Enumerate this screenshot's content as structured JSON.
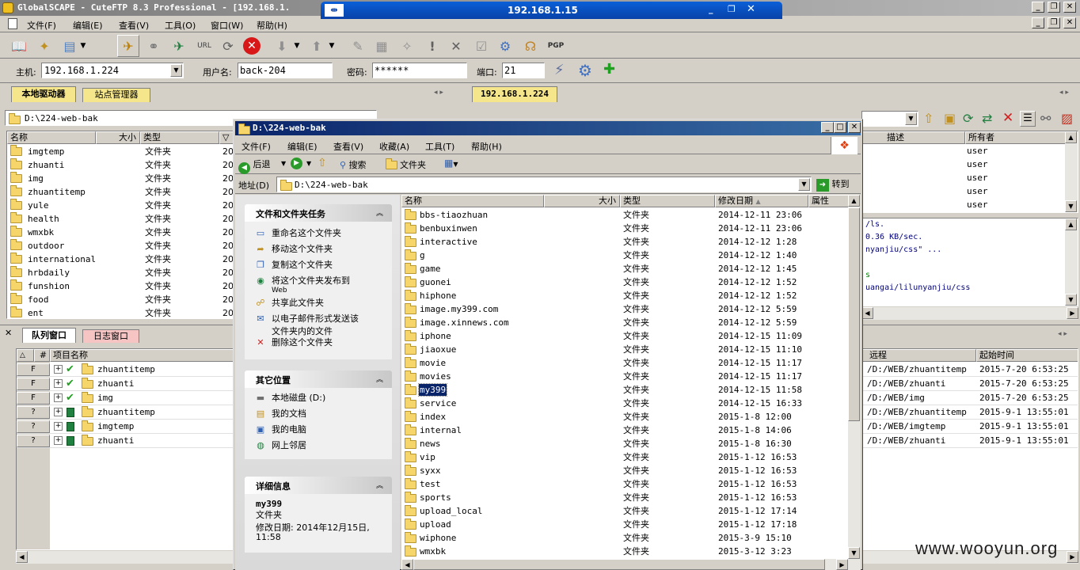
{
  "app": {
    "title": "GlobalSCAPE - CuteFTP 8.3 Professional - [192.168.1.",
    "menu": [
      "文件(F)",
      "编辑(E)",
      "查看(V)",
      "工具(O)",
      "窗口(W)",
      "帮助(H)"
    ],
    "remote_title": "192.168.1.15"
  },
  "connection": {
    "host_label": "主机:",
    "host_value": "192.168.1.224",
    "user_label": "用户名:",
    "user_value": "back-204",
    "pass_label": "密码:",
    "pass_value": "******",
    "port_label": "端口:",
    "port_value": "21"
  },
  "left_pane": {
    "tabs": [
      "本地驱动器",
      "站点管理器"
    ],
    "path": "D:\\224-web-bak",
    "columns": [
      "名称",
      "大小",
      "类型"
    ],
    "rows": [
      {
        "name": "imgtemp",
        "type": "文件夹",
        "d": "20"
      },
      {
        "name": "zhuanti",
        "type": "文件夹",
        "d": "20"
      },
      {
        "name": "img",
        "type": "文件夹",
        "d": "20"
      },
      {
        "name": "zhuantitemp",
        "type": "文件夹",
        "d": "20"
      },
      {
        "name": "yule",
        "type": "文件夹",
        "d": "20"
      },
      {
        "name": "health",
        "type": "文件夹",
        "d": "20"
      },
      {
        "name": "wmxbk",
        "type": "文件夹",
        "d": "20"
      },
      {
        "name": "outdoor",
        "type": "文件夹",
        "d": "20"
      },
      {
        "name": "international",
        "type": "文件夹",
        "d": "20"
      },
      {
        "name": "hrbdaily",
        "type": "文件夹",
        "d": "20"
      },
      {
        "name": "funshion",
        "type": "文件夹",
        "d": "20"
      },
      {
        "name": "food",
        "type": "文件夹",
        "d": "20"
      },
      {
        "name": "ent",
        "type": "文件夹",
        "d": "20"
      }
    ]
  },
  "right_pane": {
    "tab": "192.168.1.224",
    "columns": [
      "描述",
      "所有者"
    ],
    "owners": [
      "user",
      "user",
      "user",
      "user",
      "user"
    ],
    "log_lines": [
      "/ls.",
      "0.36 KB/sec.",
      "nyanjiu/css\" ...",
      "",
      "s",
      "uangai/lilunyanjiu/css"
    ]
  },
  "queue": {
    "tabs": [
      "队列窗口",
      "日志窗口"
    ],
    "columns": [
      "#",
      "项目名称"
    ],
    "right_columns": [
      "远程",
      "起始时间"
    ],
    "rows": [
      {
        "status": "F",
        "name": "zhuantitemp",
        "remote": "/D:/WEB/zhuantitemp",
        "time": "2015-7-20 6:53:25",
        "done": true
      },
      {
        "status": "F",
        "name": "zhuanti",
        "remote": "/D:/WEB/zhuanti",
        "time": "2015-7-20 6:53:25",
        "done": true
      },
      {
        "status": "F",
        "name": "img",
        "remote": "/D:/WEB/img",
        "time": "2015-7-20 6:53:25",
        "done": true
      },
      {
        "status": "?",
        "name": "zhuantitemp",
        "remote": "/D:/WEB/zhuantitemp",
        "time": "2015-9-1 13:55:01",
        "done": false
      },
      {
        "status": "?",
        "name": "imgtemp",
        "remote": "/D:/WEB/imgtemp",
        "time": "2015-9-1 13:55:01",
        "done": false
      },
      {
        "status": "?",
        "name": "zhuanti",
        "remote": "/D:/WEB/zhuanti",
        "time": "2015-9-1 13:55:01",
        "done": false
      }
    ]
  },
  "explorer": {
    "title": "D:\\224-web-bak",
    "menu": [
      "文件(F)",
      "编辑(E)",
      "查看(V)",
      "收藏(A)",
      "工具(T)",
      "帮助(H)"
    ],
    "toolbar": {
      "back": "后退",
      "search": "搜索",
      "folders": "文件夹"
    },
    "address_label": "地址(D)",
    "address_value": "D:\\224-web-bak",
    "go_label": "转到",
    "tasks": {
      "file_title": "文件和文件夹任务",
      "file_items": [
        "重命名这个文件夹",
        "移动这个文件夹",
        "复制这个文件夹",
        "将这个文件夹发布到",
        "Web",
        "共享此文件夹",
        "以电子邮件形式发送该",
        "文件夹内的文件",
        "删除这个文件夹"
      ],
      "other_title": "其它位置",
      "other_items": [
        "本地磁盘 (D:)",
        "我的文档",
        "我的电脑",
        "网上邻居"
      ],
      "detail_title": "详细信息",
      "detail_name": "my399",
      "detail_type": "文件夹",
      "detail_modified": "修改日期: 2014年12月15日,",
      "detail_modified_time": "11:58"
    },
    "columns": [
      "名称",
      "大小",
      "类型",
      "修改日期",
      "属性"
    ],
    "files": [
      {
        "name": "bbs-tiaozhuan",
        "type": "文件夹",
        "date": "2014-12-11 23:06"
      },
      {
        "name": "benbuxinwen",
        "type": "文件夹",
        "date": "2014-12-11 23:06"
      },
      {
        "name": "interactive",
        "type": "文件夹",
        "date": "2014-12-12 1:28"
      },
      {
        "name": "g",
        "type": "文件夹",
        "date": "2014-12-12 1:40"
      },
      {
        "name": "game",
        "type": "文件夹",
        "date": "2014-12-12 1:45"
      },
      {
        "name": "guonei",
        "type": "文件夹",
        "date": "2014-12-12 1:52"
      },
      {
        "name": "hiphone",
        "type": "文件夹",
        "date": "2014-12-12 1:52"
      },
      {
        "name": "image.my399.com",
        "type": "文件夹",
        "date": "2014-12-12 5:59"
      },
      {
        "name": "image.xinnews.com",
        "type": "文件夹",
        "date": "2014-12-12 5:59"
      },
      {
        "name": "iphone",
        "type": "文件夹",
        "date": "2014-12-15 11:09"
      },
      {
        "name": "jiaoxue",
        "type": "文件夹",
        "date": "2014-12-15 11:10"
      },
      {
        "name": "movie",
        "type": "文件夹",
        "date": "2014-12-15 11:17"
      },
      {
        "name": "movies",
        "type": "文件夹",
        "date": "2014-12-15 11:17"
      },
      {
        "name": "my399",
        "type": "文件夹",
        "date": "2014-12-15 11:58",
        "selected": true
      },
      {
        "name": "service",
        "type": "文件夹",
        "date": "2014-12-15 16:33"
      },
      {
        "name": "index",
        "type": "文件夹",
        "date": "2015-1-8 12:00"
      },
      {
        "name": "internal",
        "type": "文件夹",
        "date": "2015-1-8 14:06"
      },
      {
        "name": "news",
        "type": "文件夹",
        "date": "2015-1-8 16:30"
      },
      {
        "name": "vip",
        "type": "文件夹",
        "date": "2015-1-12 16:53"
      },
      {
        "name": "syxx",
        "type": "文件夹",
        "date": "2015-1-12 16:53"
      },
      {
        "name": "test",
        "type": "文件夹",
        "date": "2015-1-12 16:53"
      },
      {
        "name": "sports",
        "type": "文件夹",
        "date": "2015-1-12 16:53"
      },
      {
        "name": "upload_local",
        "type": "文件夹",
        "date": "2015-1-12 17:14"
      },
      {
        "name": "upload",
        "type": "文件夹",
        "date": "2015-1-12 17:18"
      },
      {
        "name": "wiphone",
        "type": "文件夹",
        "date": "2015-3-9 15:10"
      },
      {
        "name": "wmxbk",
        "type": "文件夹",
        "date": "2015-3-12 3:23"
      }
    ]
  },
  "watermark": "www.wooyun.org",
  "colors": {
    "title_blue": "#0a246a",
    "tab_yellow": "#f5e68c",
    "selection": "#0a246a",
    "xp_title": "#0054e3"
  }
}
